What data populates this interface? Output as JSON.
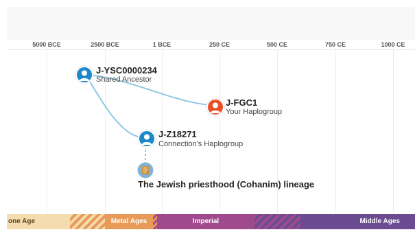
{
  "timeline": {
    "ticks": [
      "5000 BCE",
      "2500 BCE",
      "1 BCE",
      "250 CE",
      "500 CE",
      "750 CE",
      "1000 CE"
    ]
  },
  "nodes": {
    "shared": {
      "title": "J-YSC0000234",
      "subtitle": "Shared Ancestor",
      "color": "#1e88c8"
    },
    "yours": {
      "title": "J-FGC1",
      "subtitle": "Your Haplogroup",
      "color": "#e8502a"
    },
    "connection": {
      "title": "J-Z18271",
      "subtitle": "Connection's Haplogroup",
      "color": "#1e88c8"
    }
  },
  "lineage": {
    "title": "The Jewish priesthood (Cohanim) lineage",
    "icon": "book-icon"
  },
  "eras": {
    "stone": {
      "label": "one Age",
      "color": "#f4dcae"
    },
    "metal": {
      "label": "Metal Ages",
      "color": "#e99a58"
    },
    "imperial": {
      "label": "Imperial",
      "color": "#a04a8e"
    },
    "middle": {
      "label": "Middle Ages",
      "color": "#6b4c90"
    }
  },
  "colors": {
    "link": "#8ec7e3",
    "accent": "#1e88c8"
  }
}
